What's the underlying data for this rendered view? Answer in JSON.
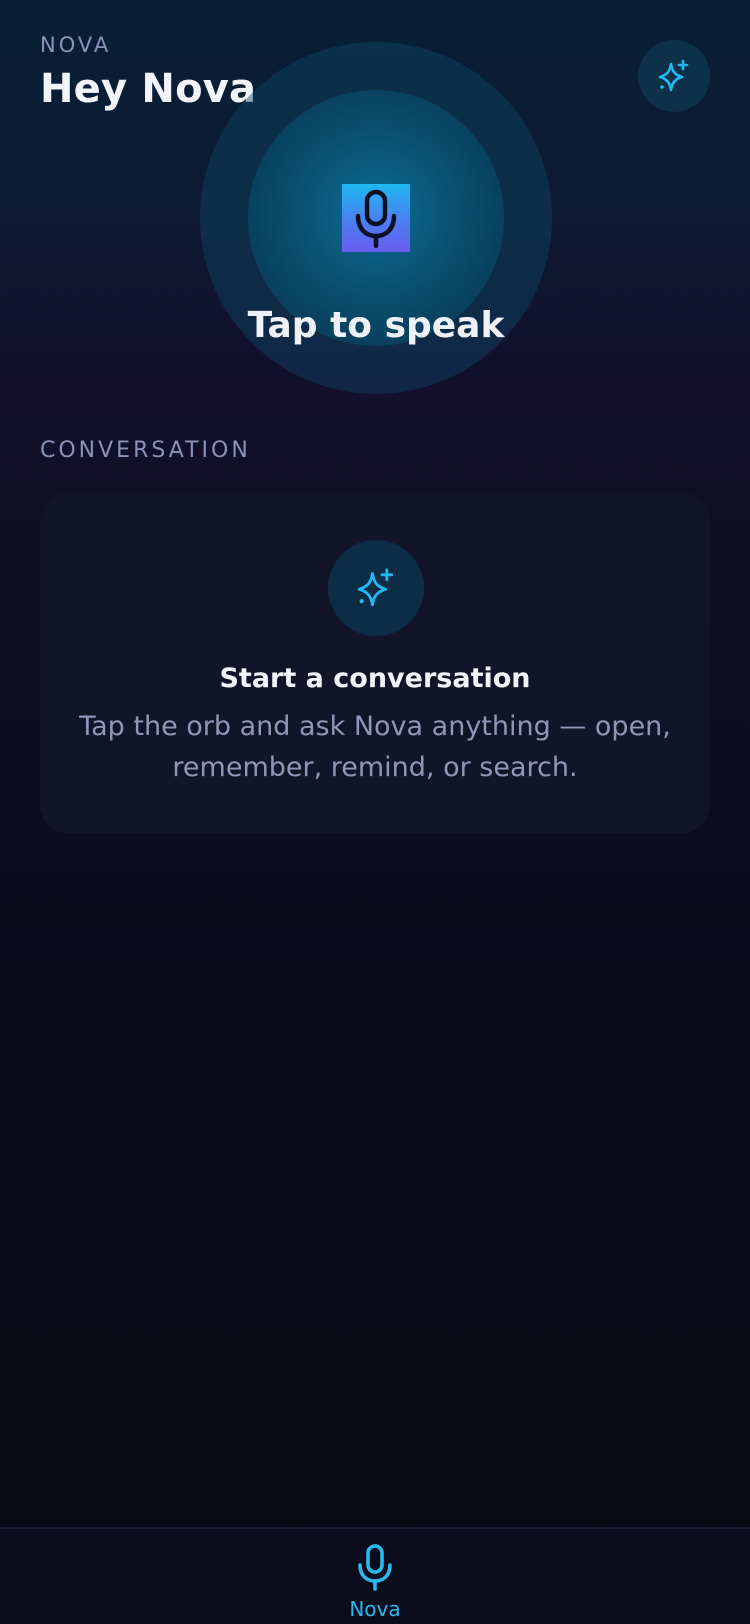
{
  "header": {
    "app_label": "NOVA",
    "title": "Hey Nova",
    "action_icon": "sparkle-icon"
  },
  "orb": {
    "prompt": "Tap to speak",
    "icon": "microphone-icon"
  },
  "conversation": {
    "section_label": "CONVERSATION",
    "empty_state": {
      "icon": "sparkle-icon",
      "title": "Start a conversation",
      "body": "Tap the orb and ask Nova anything — open, remember, remind, or search."
    }
  },
  "tab_bar": {
    "tabs": [
      {
        "label": "Nova",
        "icon": "microphone-icon",
        "active": true
      }
    ]
  },
  "colors": {
    "accent": "#2bb8ee",
    "card_background": "#121429",
    "muted_text": "#8a93b8"
  }
}
